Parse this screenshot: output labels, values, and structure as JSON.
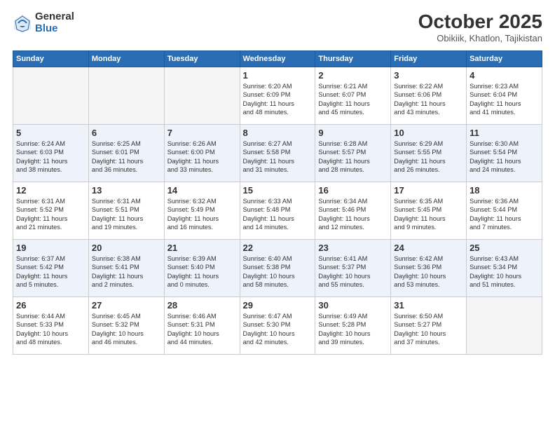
{
  "logo": {
    "general": "General",
    "blue": "Blue"
  },
  "title": "October 2025",
  "subtitle": "Obikiik, Khatlon, Tajikistan",
  "weekdays": [
    "Sunday",
    "Monday",
    "Tuesday",
    "Wednesday",
    "Thursday",
    "Friday",
    "Saturday"
  ],
  "weeks": [
    [
      {
        "day": "",
        "info": ""
      },
      {
        "day": "",
        "info": ""
      },
      {
        "day": "",
        "info": ""
      },
      {
        "day": "1",
        "info": "Sunrise: 6:20 AM\nSunset: 6:09 PM\nDaylight: 11 hours\nand 48 minutes."
      },
      {
        "day": "2",
        "info": "Sunrise: 6:21 AM\nSunset: 6:07 PM\nDaylight: 11 hours\nand 45 minutes."
      },
      {
        "day": "3",
        "info": "Sunrise: 6:22 AM\nSunset: 6:06 PM\nDaylight: 11 hours\nand 43 minutes."
      },
      {
        "day": "4",
        "info": "Sunrise: 6:23 AM\nSunset: 6:04 PM\nDaylight: 11 hours\nand 41 minutes."
      }
    ],
    [
      {
        "day": "5",
        "info": "Sunrise: 6:24 AM\nSunset: 6:03 PM\nDaylight: 11 hours\nand 38 minutes."
      },
      {
        "day": "6",
        "info": "Sunrise: 6:25 AM\nSunset: 6:01 PM\nDaylight: 11 hours\nand 36 minutes."
      },
      {
        "day": "7",
        "info": "Sunrise: 6:26 AM\nSunset: 6:00 PM\nDaylight: 11 hours\nand 33 minutes."
      },
      {
        "day": "8",
        "info": "Sunrise: 6:27 AM\nSunset: 5:58 PM\nDaylight: 11 hours\nand 31 minutes."
      },
      {
        "day": "9",
        "info": "Sunrise: 6:28 AM\nSunset: 5:57 PM\nDaylight: 11 hours\nand 28 minutes."
      },
      {
        "day": "10",
        "info": "Sunrise: 6:29 AM\nSunset: 5:55 PM\nDaylight: 11 hours\nand 26 minutes."
      },
      {
        "day": "11",
        "info": "Sunrise: 6:30 AM\nSunset: 5:54 PM\nDaylight: 11 hours\nand 24 minutes."
      }
    ],
    [
      {
        "day": "12",
        "info": "Sunrise: 6:31 AM\nSunset: 5:52 PM\nDaylight: 11 hours\nand 21 minutes."
      },
      {
        "day": "13",
        "info": "Sunrise: 6:31 AM\nSunset: 5:51 PM\nDaylight: 11 hours\nand 19 minutes."
      },
      {
        "day": "14",
        "info": "Sunrise: 6:32 AM\nSunset: 5:49 PM\nDaylight: 11 hours\nand 16 minutes."
      },
      {
        "day": "15",
        "info": "Sunrise: 6:33 AM\nSunset: 5:48 PM\nDaylight: 11 hours\nand 14 minutes."
      },
      {
        "day": "16",
        "info": "Sunrise: 6:34 AM\nSunset: 5:46 PM\nDaylight: 11 hours\nand 12 minutes."
      },
      {
        "day": "17",
        "info": "Sunrise: 6:35 AM\nSunset: 5:45 PM\nDaylight: 11 hours\nand 9 minutes."
      },
      {
        "day": "18",
        "info": "Sunrise: 6:36 AM\nSunset: 5:44 PM\nDaylight: 11 hours\nand 7 minutes."
      }
    ],
    [
      {
        "day": "19",
        "info": "Sunrise: 6:37 AM\nSunset: 5:42 PM\nDaylight: 11 hours\nand 5 minutes."
      },
      {
        "day": "20",
        "info": "Sunrise: 6:38 AM\nSunset: 5:41 PM\nDaylight: 11 hours\nand 2 minutes."
      },
      {
        "day": "21",
        "info": "Sunrise: 6:39 AM\nSunset: 5:40 PM\nDaylight: 11 hours\nand 0 minutes."
      },
      {
        "day": "22",
        "info": "Sunrise: 6:40 AM\nSunset: 5:38 PM\nDaylight: 10 hours\nand 58 minutes."
      },
      {
        "day": "23",
        "info": "Sunrise: 6:41 AM\nSunset: 5:37 PM\nDaylight: 10 hours\nand 55 minutes."
      },
      {
        "day": "24",
        "info": "Sunrise: 6:42 AM\nSunset: 5:36 PM\nDaylight: 10 hours\nand 53 minutes."
      },
      {
        "day": "25",
        "info": "Sunrise: 6:43 AM\nSunset: 5:34 PM\nDaylight: 10 hours\nand 51 minutes."
      }
    ],
    [
      {
        "day": "26",
        "info": "Sunrise: 6:44 AM\nSunset: 5:33 PM\nDaylight: 10 hours\nand 48 minutes."
      },
      {
        "day": "27",
        "info": "Sunrise: 6:45 AM\nSunset: 5:32 PM\nDaylight: 10 hours\nand 46 minutes."
      },
      {
        "day": "28",
        "info": "Sunrise: 6:46 AM\nSunset: 5:31 PM\nDaylight: 10 hours\nand 44 minutes."
      },
      {
        "day": "29",
        "info": "Sunrise: 6:47 AM\nSunset: 5:30 PM\nDaylight: 10 hours\nand 42 minutes."
      },
      {
        "day": "30",
        "info": "Sunrise: 6:49 AM\nSunset: 5:28 PM\nDaylight: 10 hours\nand 39 minutes."
      },
      {
        "day": "31",
        "info": "Sunrise: 6:50 AM\nSunset: 5:27 PM\nDaylight: 10 hours\nand 37 minutes."
      },
      {
        "day": "",
        "info": ""
      }
    ]
  ]
}
